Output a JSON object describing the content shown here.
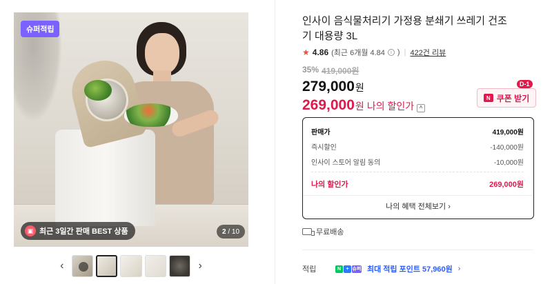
{
  "gallery": {
    "badge_top": "슈퍼적립",
    "best_pill": "최근 3일간 판매 BEST 상품",
    "counter_current": "2",
    "counter_total": "/ 10",
    "prev_arrow": "‹",
    "next_arrow": "›",
    "thumbnails": 5
  },
  "product": {
    "title": "인사이 음식물처리기 가정용 분쇄기 쓰레기 건조기 대용량 3L",
    "rating_score": "4.86",
    "rating_recent": "(최근 6개월 4.84",
    "rating_info": "i",
    "rating_close": ")",
    "review_count": "422건 리뷰",
    "discount_pct": "35%",
    "original_price": "419,000원",
    "sale_price": "279,000",
    "sale_won": "원",
    "my_price": "269,000",
    "my_won": "원",
    "my_price_label": "나의 할인가",
    "caret": "^"
  },
  "coupon": {
    "dday": "D-1",
    "label": "쿠폰 받기",
    "icon": "N"
  },
  "breakdown": {
    "rows": [
      {
        "label": "판매가",
        "value": "419,000원"
      },
      {
        "label": "즉시할인",
        "value": "-140,000원"
      },
      {
        "label": "인사이 스토어 알림 동의",
        "value": "-10,000원"
      }
    ],
    "total_label": "나의 할인가",
    "total_value": "269,000원",
    "all_benefits": "나의 혜택 전체보기 ›"
  },
  "shipping": {
    "label": "무료배송"
  },
  "points": {
    "label": "적립",
    "badge_n": "N",
    "badge_plus": "+",
    "badge_super": "슈퍼",
    "text": "최대 적립 포인트 57,960원",
    "chevron": "›"
  },
  "colors": {
    "accent_red": "#e0184b",
    "super_purple": "#7b61ff",
    "point_blue": "#2b5cff"
  }
}
